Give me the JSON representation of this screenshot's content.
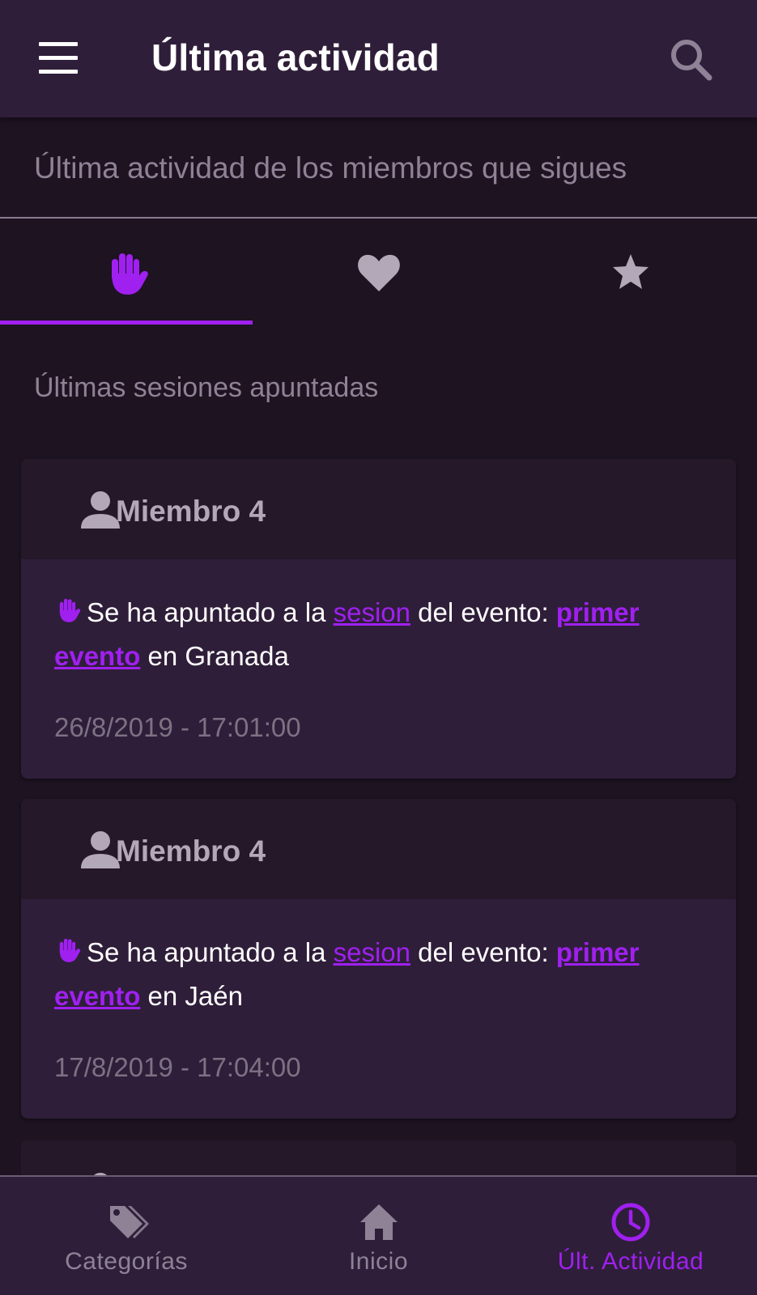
{
  "topbar": {
    "title": "Última actividad",
    "menu_icon": "menu-icon",
    "search_icon": "search-icon"
  },
  "subheader": {
    "text": "Última actividad de los miembros que sigues"
  },
  "tabs": [
    {
      "icon": "hand-icon",
      "active": true
    },
    {
      "icon": "heart-icon",
      "active": false
    },
    {
      "icon": "star-icon",
      "active": false
    }
  ],
  "section_title": "Últimas sesiones apuntadas",
  "cards": [
    {
      "member": "Miembro 4",
      "text_before": "Se ha apuntado a la ",
      "session_link": "sesion",
      "text_middle": " del evento: ",
      "event_link": "primer evento",
      "text_location": " en Granada",
      "date": "26/8/2019 - 17:01:00"
    },
    {
      "member": "Miembro 4",
      "text_before": "Se ha apuntado a la ",
      "session_link": "sesion",
      "text_middle": " del evento: ",
      "event_link": "primer evento",
      "text_location": " en Jaén",
      "date": "17/8/2019 - 17:04:00"
    }
  ],
  "bottom_nav": [
    {
      "label": "Categorías",
      "icon": "tags-icon",
      "active": false
    },
    {
      "label": "Inicio",
      "icon": "home-icon",
      "active": false
    },
    {
      "label": "Últ. Actividad",
      "icon": "clock-icon",
      "active": true
    }
  ],
  "colors": {
    "accent": "#a020f0",
    "background": "#1d1321",
    "surface": "#2f1e39",
    "card_header": "#241829",
    "muted_text": "#8f8296"
  }
}
